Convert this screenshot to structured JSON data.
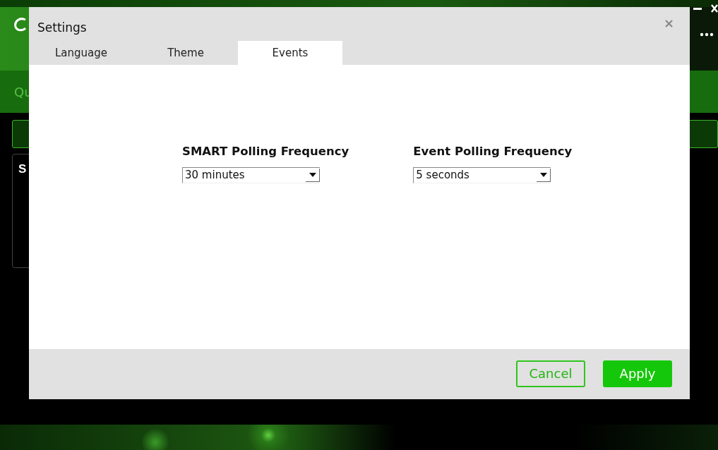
{
  "app": {
    "nav_label": "Qu",
    "panel_heading": "S"
  },
  "dialog": {
    "title": "Settings",
    "close": "×",
    "tabs": [
      {
        "label": "Language",
        "selected": false
      },
      {
        "label": "Theme",
        "selected": false
      },
      {
        "label": "Events",
        "selected": true
      }
    ],
    "fields": [
      {
        "label": "SMART Polling Frequency",
        "value": "30 minutes"
      },
      {
        "label": "Event Polling Frequency",
        "value": "5 seconds"
      }
    ],
    "buttons": [
      {
        "label": "Cancel",
        "kind": "secondary"
      },
      {
        "label": "Apply",
        "kind": "primary"
      }
    ]
  }
}
